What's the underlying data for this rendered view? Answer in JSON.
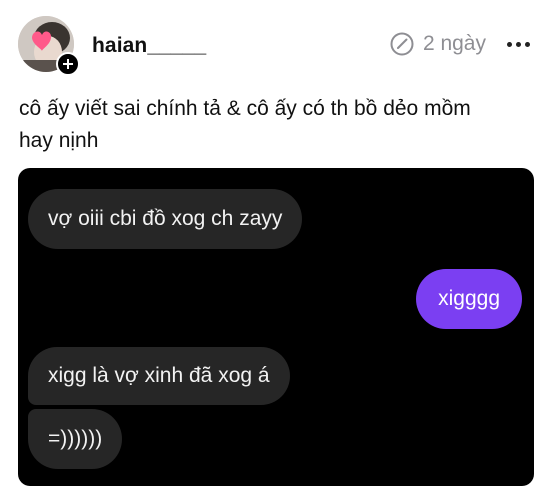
{
  "post": {
    "username": "haian_____",
    "time": "2 ngày",
    "caption_line1": "cô ấy viết sai chính tả & cô ấy có th bồ dẻo mồm",
    "caption_line2": "hay nịnh"
  },
  "chat": {
    "messages": [
      {
        "side": "incoming",
        "text": "vợ oiii cbi đồ xog ch zayy"
      },
      {
        "side": "outgoing",
        "text": "xigggg"
      },
      {
        "side": "incoming",
        "text": "xigg là vợ xinh đã xog á"
      },
      {
        "side": "incoming",
        "text": "=))))))"
      }
    ]
  },
  "colors": {
    "outgoing_bubble": "#7b3ff2",
    "incoming_bubble": "#262626",
    "chat_background": "#000000",
    "meta_text": "#8e8e93"
  },
  "icons": [
    "avatar",
    "follow-plus-icon",
    "edited-icon",
    "more-icon"
  ]
}
